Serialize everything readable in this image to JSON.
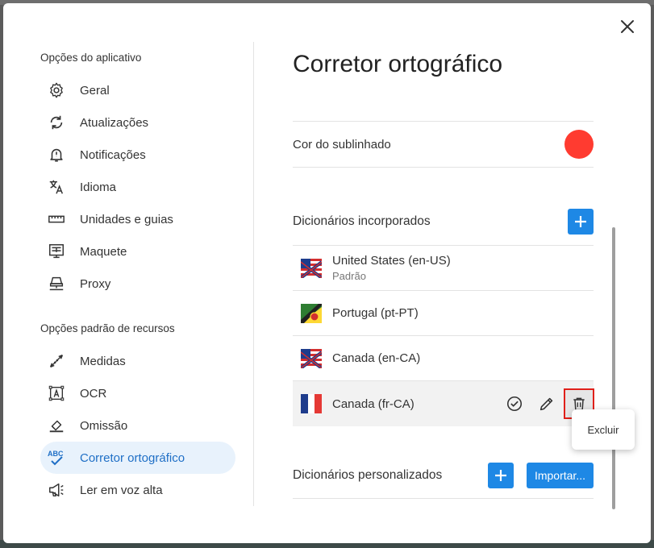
{
  "dialog": {
    "close_icon": "close-icon"
  },
  "sidebar": {
    "section1_title": "Opções do aplicativo",
    "section1_items": [
      {
        "label": "Geral",
        "icon": "gear-icon"
      },
      {
        "label": "Atualizações",
        "icon": "sync-icon"
      },
      {
        "label": "Notificações",
        "icon": "bell-icon"
      },
      {
        "label": "Idioma",
        "icon": "translate-icon"
      },
      {
        "label": "Unidades e guias",
        "icon": "ruler-icon"
      },
      {
        "label": "Maquete",
        "icon": "layout-icon"
      },
      {
        "label": "Proxy",
        "icon": "network-icon"
      }
    ],
    "section2_title": "Opções padrão de recursos",
    "section2_items": [
      {
        "label": "Medidas",
        "icon": "measure-icon"
      },
      {
        "label": "OCR",
        "icon": "ocr-icon"
      },
      {
        "label": "Omissão",
        "icon": "eraser-icon"
      },
      {
        "label": "Corretor ortográfico",
        "icon": "spellcheck-icon",
        "active": true
      },
      {
        "label": "Ler em voz alta",
        "icon": "megaphone-icon"
      }
    ]
  },
  "main": {
    "title": "Corretor ortográfico",
    "underline_color_label": "Cor do sublinhado",
    "underline_color": "#ff3b30",
    "builtin_title": "Dicionários incorporados",
    "builtin": [
      {
        "name": "United States (en-US)",
        "sub": "Padrão",
        "flag": "us-flag"
      },
      {
        "name": "Portugal (pt-PT)",
        "sub": "",
        "flag": "pt-flag"
      },
      {
        "name": "Canada (en-CA)",
        "sub": "",
        "flag": "us-flag"
      },
      {
        "name": "Canada (fr-CA)",
        "sub": "",
        "flag": "fr-flag",
        "selected": true
      }
    ],
    "custom_title": "Dicionários personalizados",
    "import_label": "Importar...",
    "tooltip": "Excluir"
  },
  "colors": {
    "accent": "#1e88e5",
    "active_bg": "#e8f2fc",
    "active_text": "#1f6fc6",
    "highlight_border": "#e0201a"
  }
}
